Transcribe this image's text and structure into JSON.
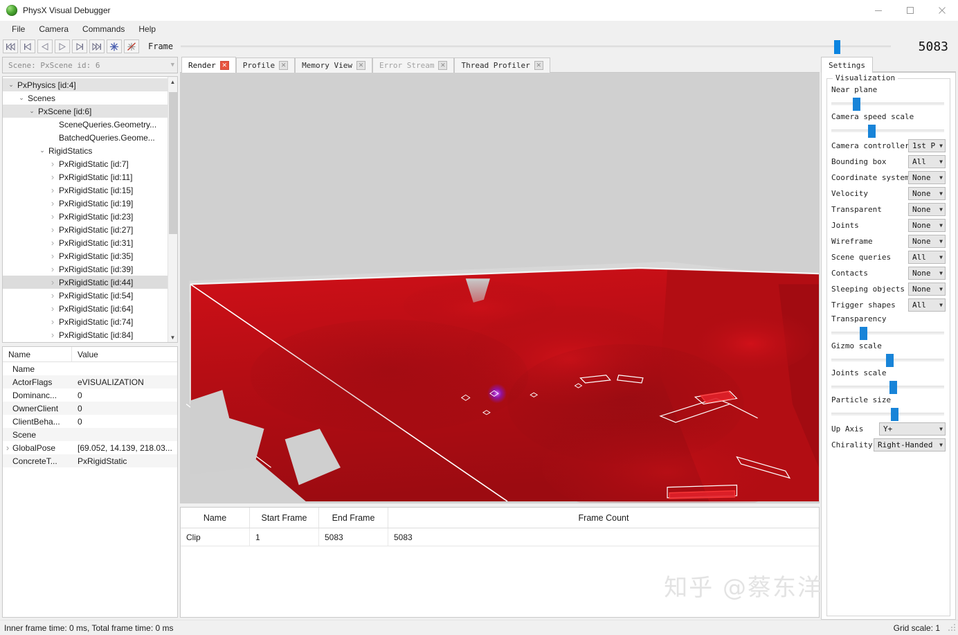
{
  "window": {
    "title": "PhysX Visual Debugger",
    "app_icon": "physx-sphere-icon",
    "minimize": "minimize-icon",
    "maximize": "maximize-icon",
    "close": "close-icon"
  },
  "menu": {
    "items": [
      {
        "label": "File"
      },
      {
        "label": "Camera"
      },
      {
        "label": "Commands"
      },
      {
        "label": "Help"
      }
    ]
  },
  "toolbar": {
    "buttons": [
      {
        "name": "go-to-start-icon"
      },
      {
        "name": "step-back-frame-icon"
      },
      {
        "name": "play-reverse-icon"
      },
      {
        "name": "play-icon"
      },
      {
        "name": "step-forward-frame-icon"
      },
      {
        "name": "go-to-end-icon"
      },
      {
        "name": "capture-frame-icon"
      },
      {
        "name": "stop-capture-icon"
      }
    ],
    "frame_label": "Frame",
    "frame_value": "5083",
    "frame_slider_percent": 92
  },
  "left": {
    "scene_combo": {
      "value": "Scene: PxScene id: 6",
      "arrow": "chevron-down-icon"
    },
    "tree": [
      {
        "label": "PxPhysics [id:4]",
        "indent": 0,
        "chev": "expanded",
        "selected": true
      },
      {
        "label": "Scenes",
        "indent": 1,
        "chev": "expanded",
        "selected": false
      },
      {
        "label": "PxScene [id:6]",
        "indent": 2,
        "chev": "expanded",
        "selected": true
      },
      {
        "label": "SceneQueries.Geometry...",
        "indent": 4,
        "chev": "none",
        "selected": false
      },
      {
        "label": "BatchedQueries.Geome...",
        "indent": 4,
        "chev": "none",
        "selected": false
      },
      {
        "label": "RigidStatics",
        "indent": 3,
        "chev": "expanded",
        "selected": false
      },
      {
        "label": "PxRigidStatic [id:7]",
        "indent": 4,
        "chev": "collapsed",
        "selected": false
      },
      {
        "label": "PxRigidStatic [id:11]",
        "indent": 4,
        "chev": "collapsed",
        "selected": false
      },
      {
        "label": "PxRigidStatic [id:15]",
        "indent": 4,
        "chev": "collapsed",
        "selected": false
      },
      {
        "label": "PxRigidStatic [id:19]",
        "indent": 4,
        "chev": "collapsed",
        "selected": false
      },
      {
        "label": "PxRigidStatic [id:23]",
        "indent": 4,
        "chev": "collapsed",
        "selected": false
      },
      {
        "label": "PxRigidStatic [id:27]",
        "indent": 4,
        "chev": "collapsed",
        "selected": false
      },
      {
        "label": "PxRigidStatic [id:31]",
        "indent": 4,
        "chev": "collapsed",
        "selected": false
      },
      {
        "label": "PxRigidStatic [id:35]",
        "indent": 4,
        "chev": "collapsed",
        "selected": false
      },
      {
        "label": "PxRigidStatic [id:39]",
        "indent": 4,
        "chev": "collapsed",
        "selected": false
      },
      {
        "label": "PxRigidStatic [id:44]",
        "indent": 4,
        "chev": "collapsed",
        "selected": true
      },
      {
        "label": "PxRigidStatic [id:54]",
        "indent": 4,
        "chev": "collapsed",
        "selected": false
      },
      {
        "label": "PxRigidStatic [id:64]",
        "indent": 4,
        "chev": "collapsed",
        "selected": false
      },
      {
        "label": "PxRigidStatic [id:74]",
        "indent": 4,
        "chev": "collapsed",
        "selected": false
      },
      {
        "label": "PxRigidStatic [id:84]",
        "indent": 4,
        "chev": "collapsed",
        "selected": false
      }
    ],
    "properties": {
      "headers": {
        "name": "Name",
        "value": "Value"
      },
      "rows": [
        {
          "name": "Name",
          "value": "",
          "expandable": false
        },
        {
          "name": "ActorFlags",
          "value": "eVISUALIZATION",
          "expandable": false
        },
        {
          "name": "Dominanc...",
          "value": "0",
          "expandable": false
        },
        {
          "name": "OwnerClient",
          "value": "0",
          "expandable": false
        },
        {
          "name": "ClientBeha...",
          "value": "0",
          "expandable": false
        },
        {
          "name": "Scene",
          "value": "",
          "expandable": false
        },
        {
          "name": "GlobalPose",
          "value": "[69.052, 14.139, 218.03...",
          "expandable": true
        },
        {
          "name": "ConcreteT...",
          "value": "PxRigidStatic",
          "expandable": false
        }
      ]
    }
  },
  "center": {
    "tabs": [
      {
        "label": "Render",
        "active": true,
        "dim": false,
        "close": "close-icon"
      },
      {
        "label": "Profile",
        "active": false,
        "dim": false,
        "close": "close-icon"
      },
      {
        "label": "Memory View",
        "active": false,
        "dim": false,
        "close": "close-icon"
      },
      {
        "label": "Error Stream",
        "active": false,
        "dim": true,
        "close": "close-icon"
      },
      {
        "label": "Thread Profiler",
        "active": false,
        "dim": false,
        "close": "close-icon"
      }
    ],
    "render": {
      "background_color": "#d0d0d0",
      "terrain_color": "#c80f17",
      "terrain_shadow_color": "#8f0d13",
      "wire_color": "#ffffff",
      "highlight_color": "#ff2d2d",
      "marker_color": "#9b22d6"
    },
    "clips": {
      "headers": [
        "Name",
        "Start Frame",
        "End Frame",
        "Frame Count"
      ],
      "rows": [
        {
          "name": "Clip",
          "start": "1",
          "end": "5083",
          "count": "5083"
        }
      ]
    }
  },
  "right": {
    "tab": "Settings",
    "group_title": "Visualization",
    "sliders": [
      {
        "label": "Near plane",
        "percent": 19
      },
      {
        "label": "Camera speed scale",
        "percent": 32
      },
      {
        "label": "Transparency",
        "percent": 25
      },
      {
        "label": "Gizmo scale",
        "percent": 48
      },
      {
        "label": "Joints scale",
        "percent": 51
      },
      {
        "label": "Particle size",
        "percent": 52
      }
    ],
    "options": [
      {
        "label": "Camera controller",
        "value": "1st P",
        "arrow": "chevron-down-icon",
        "width": "normal"
      },
      {
        "label": "Bounding box",
        "value": "All",
        "arrow": "chevron-down-icon",
        "width": "normal"
      },
      {
        "label": "Coordinate system",
        "value": "None",
        "arrow": "chevron-down-icon",
        "width": "normal"
      },
      {
        "label": "Velocity",
        "value": "None",
        "arrow": "chevron-down-icon",
        "width": "normal"
      },
      {
        "label": "Transparent",
        "value": "None",
        "arrow": "chevron-down-icon",
        "width": "normal"
      },
      {
        "label": "Joints",
        "value": "None",
        "arrow": "chevron-down-icon",
        "width": "normal"
      },
      {
        "label": "Wireframe",
        "value": "None",
        "arrow": "chevron-down-icon",
        "width": "normal"
      },
      {
        "label": "Scene queries",
        "value": "All",
        "arrow": "chevron-down-icon",
        "width": "normal"
      },
      {
        "label": "Contacts",
        "value": "None",
        "arrow": "chevron-down-icon",
        "width": "normal"
      },
      {
        "label": "Sleeping objects",
        "value": "None",
        "arrow": "chevron-down-icon",
        "width": "normal"
      },
      {
        "label": "Trigger shapes",
        "value": "All",
        "arrow": "chevron-down-icon",
        "width": "normal"
      }
    ],
    "bottom_options": [
      {
        "label": "Up Axis",
        "value": "Y+",
        "arrow": "chevron-down-icon",
        "width": "wide"
      },
      {
        "label": "Chirality",
        "value": "Right-Handed",
        "arrow": "chevron-down-icon",
        "width": "xwide"
      }
    ]
  },
  "status": {
    "left": "Inner frame time: 0 ms, Total frame time: 0 ms",
    "right": "Grid scale: 1"
  },
  "watermark": "知乎 @蔡东洋"
}
